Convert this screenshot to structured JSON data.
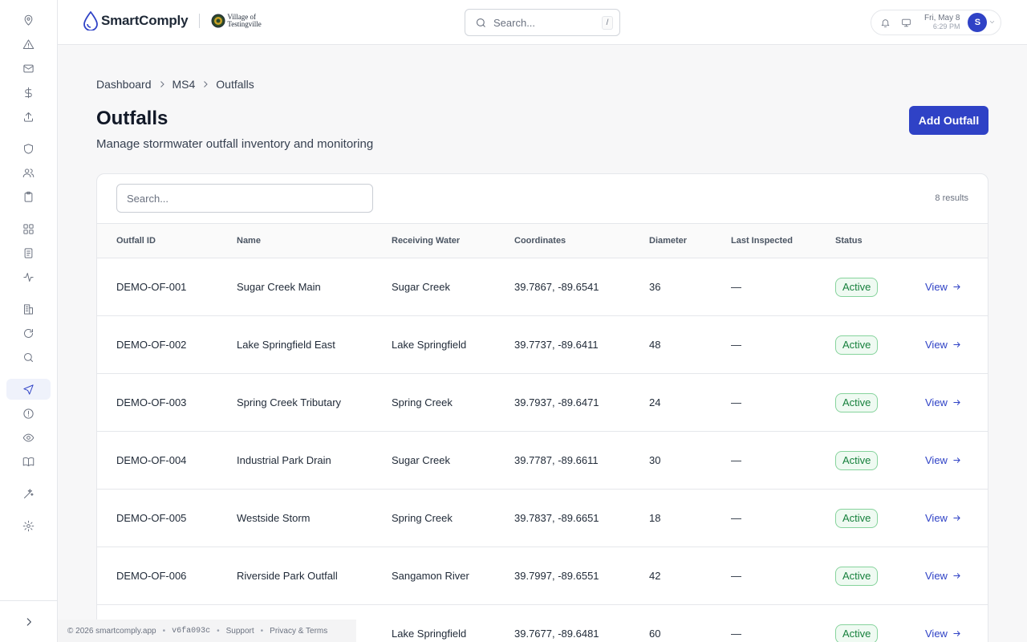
{
  "sidebar": {
    "icons": [
      "map-pin-icon",
      "alert-triangle-icon",
      "mail-icon",
      "dollar-icon",
      "upload-icon",
      "shield-icon",
      "users-icon",
      "clipboard-icon",
      "grid-icon",
      "file-text-icon",
      "activity-icon",
      "building-icon",
      "refresh-icon",
      "search-icon",
      "navigation-icon",
      "alert-circle-icon",
      "eye-icon",
      "book-icon",
      "sparkles-icon",
      "gear-icon"
    ],
    "active": "navigation-icon",
    "expand_icon": "chevron-right-icon"
  },
  "header": {
    "brand": "SmartComply",
    "village_line1": "Village of",
    "village_line2": "Testingville",
    "search_placeholder": "Search...",
    "search_shortcut": "/",
    "date": "Fri, May 8",
    "time": "6:29 PM",
    "avatar_initial": "S"
  },
  "breadcrumb": [
    "Dashboard",
    "MS4",
    "Outfalls"
  ],
  "page": {
    "title": "Outfalls",
    "subtitle": "Manage stormwater outfall inventory and monitoring",
    "add_button": "Add Outfall"
  },
  "table": {
    "search_placeholder": "Search...",
    "results": "8 results",
    "columns": [
      "Outfall ID",
      "Name",
      "Receiving Water",
      "Coordinates",
      "Diameter",
      "Last Inspected",
      "Status"
    ],
    "view_label": "View",
    "rows": [
      {
        "id": "DEMO-OF-001",
        "name": "Sugar Creek Main",
        "water": "Sugar Creek",
        "coords": "39.7867, -89.6541",
        "diameter": "36",
        "inspected": "—",
        "status": "Active"
      },
      {
        "id": "DEMO-OF-002",
        "name": "Lake Springfield East",
        "water": "Lake Springfield",
        "coords": "39.7737, -89.6411",
        "diameter": "48",
        "inspected": "—",
        "status": "Active"
      },
      {
        "id": "DEMO-OF-003",
        "name": "Spring Creek Tributary",
        "water": "Spring Creek",
        "coords": "39.7937, -89.6471",
        "diameter": "24",
        "inspected": "—",
        "status": "Active"
      },
      {
        "id": "DEMO-OF-004",
        "name": "Industrial Park Drain",
        "water": "Sugar Creek",
        "coords": "39.7787, -89.6611",
        "diameter": "30",
        "inspected": "—",
        "status": "Active"
      },
      {
        "id": "DEMO-OF-005",
        "name": "Westside Storm",
        "water": "Spring Creek",
        "coords": "39.7837, -89.6651",
        "diameter": "18",
        "inspected": "—",
        "status": "Active"
      },
      {
        "id": "DEMO-OF-006",
        "name": "Riverside Park Outfall",
        "water": "Sangamon River",
        "coords": "39.7997, -89.6551",
        "diameter": "42",
        "inspected": "—",
        "status": "Active"
      },
      {
        "id": "",
        "name": "",
        "water": "Lake Springfield",
        "coords": "39.7677, -89.6481",
        "diameter": "60",
        "inspected": "—",
        "status": "Active"
      }
    ]
  },
  "footer": {
    "copyright": "© 2026 smartcomply.app",
    "version": "v6fa093c",
    "support": "Support",
    "privacy": "Privacy & Terms"
  }
}
